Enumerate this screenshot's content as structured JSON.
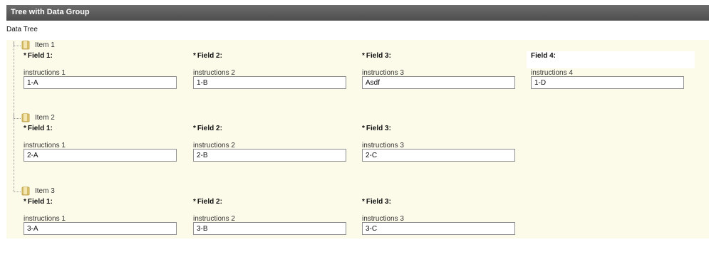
{
  "window": {
    "title": "Tree with Data Group"
  },
  "tree_title": "Data Tree",
  "items": [
    {
      "label": "Item 1",
      "fields": [
        {
          "label": "Field 1:",
          "required": true,
          "instructions": "instructions 1",
          "value": "1-A"
        },
        {
          "label": "Field 2:",
          "required": true,
          "instructions": "instructions 2",
          "value": "1-B"
        },
        {
          "label": "Field 3:",
          "required": true,
          "instructions": "instructions 3",
          "value": "Asdf"
        },
        {
          "label": "Field 4:",
          "required": false,
          "instructions": "instructions 4",
          "value": "1-D"
        }
      ]
    },
    {
      "label": "Item 2",
      "fields": [
        {
          "label": "Field 1:",
          "required": true,
          "instructions": "instructions 1",
          "value": "2-A"
        },
        {
          "label": "Field 2:",
          "required": true,
          "instructions": "instructions 2",
          "value": "2-B"
        },
        {
          "label": "Field 3:",
          "required": true,
          "instructions": "instructions 3",
          "value": "2-C"
        }
      ]
    },
    {
      "label": "Item 3",
      "fields": [
        {
          "label": "Field 1:",
          "required": true,
          "instructions": "instructions 1",
          "value": "3-A"
        },
        {
          "label": "Field 2:",
          "required": true,
          "instructions": "instructions 2",
          "value": "3-B"
        },
        {
          "label": "Field 3:",
          "required": true,
          "instructions": "instructions 3",
          "value": "3-C"
        }
      ]
    }
  ],
  "required_marker": "*",
  "icons": {
    "node_icon": "folder-icon"
  },
  "colors": {
    "titlebar": "#555555",
    "tree_background": "#fcfbea",
    "input_border": "#8e8e8e"
  }
}
